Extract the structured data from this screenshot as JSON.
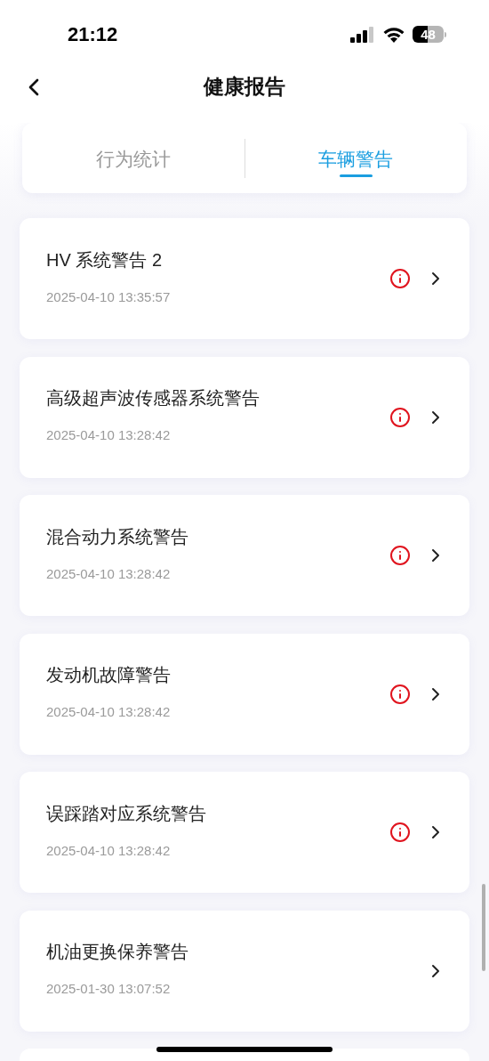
{
  "status_bar": {
    "time": "21:12",
    "battery": "48"
  },
  "header": {
    "title": "健康报告"
  },
  "tabs": [
    {
      "label": "行为统计",
      "selected": false
    },
    {
      "label": "车辆警告",
      "selected": true
    }
  ],
  "warnings": [
    {
      "title": "HV 系统警告 2",
      "time": "2025-04-10 13:35:57",
      "alert": true
    },
    {
      "title": "高级超声波传感器系统警告",
      "time": "2025-04-10 13:28:42",
      "alert": true
    },
    {
      "title": "混合动力系统警告",
      "time": "2025-04-10 13:28:42",
      "alert": true
    },
    {
      "title": "发动机故障警告",
      "time": "2025-04-10 13:28:42",
      "alert": true
    },
    {
      "title": "误踩踏对应系统警告",
      "time": "2025-04-10 13:28:42",
      "alert": true
    },
    {
      "title": "机油更换保养警告",
      "time": "2025-01-30 13:07:52",
      "alert": false
    }
  ]
}
